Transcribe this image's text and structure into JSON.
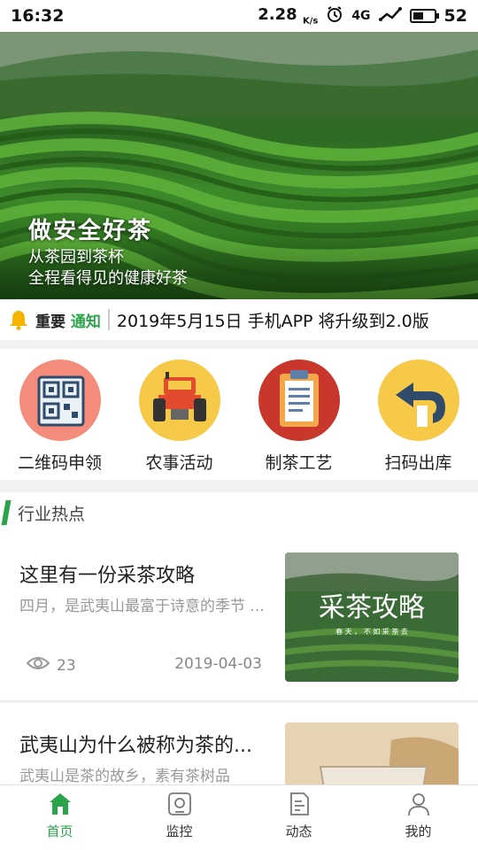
{
  "status_bar": {
    "time": "16:32",
    "speed": "2.28",
    "speed_unit": "K/s",
    "network": "4G",
    "battery": "52",
    "battery_level": 0.52
  },
  "banner": {
    "slogan_main": "做安全好茶",
    "slogan_sub1": "从茶园到茶杯",
    "slogan_sub2": "全程看得见的健康好茶",
    "slide_count": 4,
    "active_slide": 1
  },
  "notice": {
    "tag_part1": "重要",
    "tag_part2": "通知",
    "message": "2019年5月15日 手机APP 将升级到2.0版"
  },
  "quick_menu": {
    "items": [
      {
        "label": "二维码申领",
        "icon": "qr-code-icon"
      },
      {
        "label": "农事活动",
        "icon": "tractor-icon"
      },
      {
        "label": "制茶工艺",
        "icon": "clipboard-icon"
      },
      {
        "label": "扫码出库",
        "icon": "return-arrow-icon"
      }
    ]
  },
  "section": {
    "title": "行业热点"
  },
  "news": [
    {
      "title": "这里有一份采茶攻略",
      "desc": "四月，是武夷山最富于诗意的季节 ...",
      "views": "23",
      "date": "2019-04-03",
      "thumb_title": "采茶攻略",
      "thumb_sub": "春 天 ， 不 如 采 茶 去"
    },
    {
      "title": "武夷山为什么被称为茶的...",
      "desc": "武夷山是茶的故乡，素有茶树品"
    }
  ],
  "tabbar": {
    "tabs": [
      {
        "label": "首页",
        "active": true
      },
      {
        "label": "监控",
        "active": false
      },
      {
        "label": "动态",
        "active": false
      },
      {
        "label": "我的",
        "active": false
      }
    ]
  },
  "colors": {
    "accent": "#2aa34a",
    "text": "#222222",
    "muted": "#999999"
  }
}
